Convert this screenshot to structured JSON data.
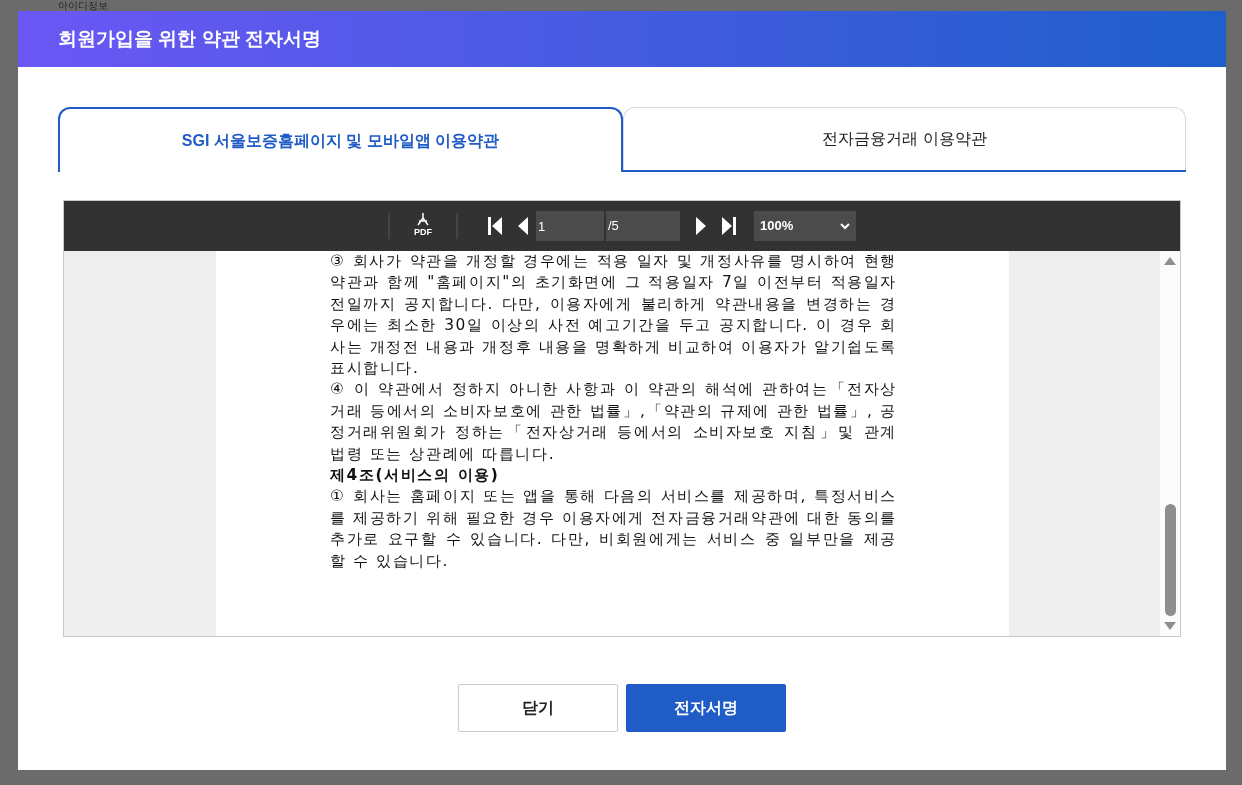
{
  "background_page": {
    "title": "아이디정보"
  },
  "dialog": {
    "title": "회원가입을 위한 약관 전자서명"
  },
  "tabs": [
    {
      "label": "SGI 서울보증홈페이지 및 모바일앱 이용약관",
      "selected": true
    },
    {
      "label": "전자금융거래 이용약관",
      "selected": false
    }
  ],
  "pdf_viewer": {
    "toolbar": {
      "pdf_label": "PDF",
      "page": "1",
      "page_total": "/5",
      "zoom": "100%"
    },
    "paragraphs": [
      {
        "kind": "body",
        "text": "③ 회사가 약관을 개정할 경우에는 적용 일자 및 개정사유를 명시하여 현행 약관과 함께 \"홈페이지\"의 초기화면에 그 적용일자 7일 이전부터 적용일자 전일까지 공지합니다. 다만, 이용자에게 불리하게 약관내용을 변경하는 경우에는 최소한 30일 이상의 사전 예고기간을 두고 공지합니다. 이 경우 회사는 개정전 내용과 개정후 내용을 명확하게 비교하여 이용자가 알기쉽도록 표시합니다."
      },
      {
        "kind": "body",
        "text": "④ 이 약관에서 정하지 아니한 사항과 이 약관의 해석에 관하여는「전자상거래 등에서의 소비자보호에 관한 법률」,「약관의 규제에 관한 법률」, 공정거래위원회가 정하는「전자상거래 등에서의 소비자보호 지침」및 관계 법령 또는 상관례에 따릅니다."
      },
      {
        "kind": "heading",
        "text": "제4조(서비스의 이용)"
      },
      {
        "kind": "body",
        "text": "① 회사는 홈페이지 또는 앱을 통해 다음의 서비스를 제공하며, 특정서비스를 제공하기 위해 필요한 경우 이용자에게 전자금융거래약관에 대한 동의를 추가로 요구할 수 있습니다. 다만, 비회원에게는 서비스 중 일부만을 제공할 수 있습니다."
      }
    ]
  },
  "buttons": [
    {
      "label": "닫기",
      "kind": "secondary"
    },
    {
      "label": "전자서명",
      "kind": "primary"
    }
  ]
}
